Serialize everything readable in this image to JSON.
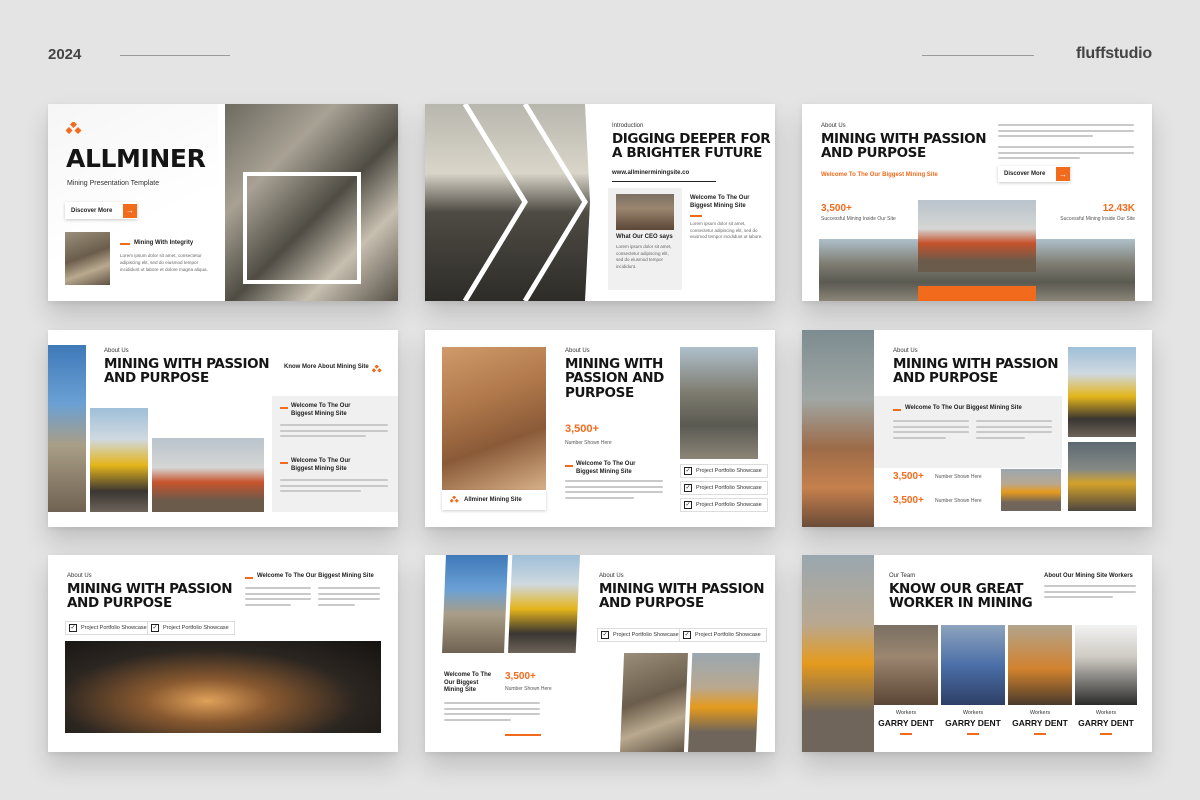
{
  "header": {
    "year": "2024",
    "brand": "fluffstudio"
  },
  "slide1": {
    "title": "ALLMINER",
    "subtitle": "Mining Presentation Template",
    "button": "Discover More",
    "item_title": "Mining With Integrity",
    "item_text": "Lorem ipsum dolor sit amet, consectetur adipiscing elit, sed do eiusmod tempor incididunt ut labore et dolore magna aliqua."
  },
  "slide2": {
    "eyebrow": "Introduction",
    "title": "DIGGING DEEPER FOR A BRIGHTER FUTURE",
    "url": "www.allminerminingsite.co",
    "ceo_label": "What Our CEO says",
    "ceo_text": "Lorem ipsum dolor sit amet, consectetur adipiscing elit, sed do eiusmod tempor incididunt.",
    "welcome": "Welcome To The Our Biggest Mining Site",
    "welcome_text": "Lorem ipsum dolor sit amet, consectetur adipiscing elit, sed do eiusmod tempor incididunt ut labore."
  },
  "slide3": {
    "eyebrow": "About Us",
    "title": "MINING WITH PASSION AND PURPOSE",
    "welcome": "Welcome To The Our Biggest Mining Site",
    "button": "Discover More",
    "stat1": "3,500+",
    "stat1_label": "Successful Mining Inside Our Site",
    "stat2": "12.43K",
    "stat2_label": "Successful Mining Inside Our Site"
  },
  "slide4": {
    "eyebrow": "About Us",
    "title": "MINING WITH PASSION AND PURPOSE",
    "know_more": "Know More About Mining Site",
    "item1": "Welcome To The Our Biggest Mining Site",
    "item2": "Welcome To The Our Biggest Mining Site"
  },
  "slide5": {
    "eyebrow": "About Us",
    "title": "MINING WITH PASSION AND PURPOSE",
    "stat": "3,500+",
    "stat_label": "Number Shown Here",
    "welcome": "Welcome To The Our Biggest Mining Site",
    "caption": "Allminer Mining Site",
    "checks": [
      "Project Portfolio Showcase",
      "Project Portfolio Showcase",
      "Project Portfolio Showcase"
    ]
  },
  "slide6": {
    "eyebrow": "About Us",
    "title": "MINING WITH PASSION AND PURPOSE",
    "welcome": "Welcome To The Our Biggest Mining Site",
    "stat1": "3,500+",
    "stat1_label": "Number Shown Here",
    "stat2": "3,500+",
    "stat2_label": "Number Shown Here"
  },
  "slide7": {
    "eyebrow": "About Us",
    "title": "MINING WITH PASSION AND PURPOSE",
    "welcome": "Welcome To The Our Biggest Mining Site",
    "checks": [
      "Project Portfolio Showcase",
      "Project Portfolio Showcase"
    ]
  },
  "slide8": {
    "eyebrow": "About Us",
    "title": "MINING WITH PASSION AND PURPOSE",
    "checks": [
      "Project Portfolio Showcase",
      "Project Portfolio Showcase"
    ],
    "welcome": "Welcome To The Our Biggest Mining Site",
    "stat": "3,500+",
    "stat_label": "Number Shown Here"
  },
  "slide9": {
    "eyebrow": "Our Team",
    "title": "KNOW OUR GREAT WORKER IN MINING",
    "side_title": "About Our Mining Site Workers",
    "workers": [
      {
        "role": "Workers",
        "name": "GARRY DENT"
      },
      {
        "role": "Workers",
        "name": "GARRY DENT"
      },
      {
        "role": "Workers",
        "name": "GARRY DENT"
      },
      {
        "role": "Workers",
        "name": "GARRY DENT"
      }
    ]
  },
  "colors": {
    "accent": "#f26b1d",
    "background": "#e4e4e4",
    "heading": "#151515"
  },
  "icons": [
    "diamond-logo-icon",
    "arrow-right-icon",
    "check-icon"
  ]
}
